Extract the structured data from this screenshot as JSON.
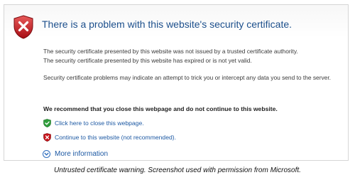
{
  "page": {
    "title": "There is a problem with this website's security certificate.",
    "line1": "The security certificate presented by this website was not issued by a trusted certificate authority.",
    "line2": "The security certificate presented by this website has expired or is not yet valid.",
    "para2": "Security certificate problems may indicate an attempt to trick you or intercept any data you send to the server.",
    "recommend": "We recommend that you close this webpage and do not continue to this website.",
    "close_link": "Click here to close this webpage.",
    "continue_link": "Continue to this website (not recommended).",
    "more_info": "More information"
  },
  "caption": "Untrusted certificate warning. Screenshot used with permission from Microsoft.",
  "icons": {
    "header": "shield-error-icon",
    "close": "green-shield-check-icon",
    "continue": "red-shield-x-icon",
    "more": "expand-circle-down-icon"
  },
  "colors": {
    "title": "#1c4f8c",
    "link": "#1d59a3",
    "error_red": "#c8161d",
    "ok_green": "#2f9e3b"
  }
}
